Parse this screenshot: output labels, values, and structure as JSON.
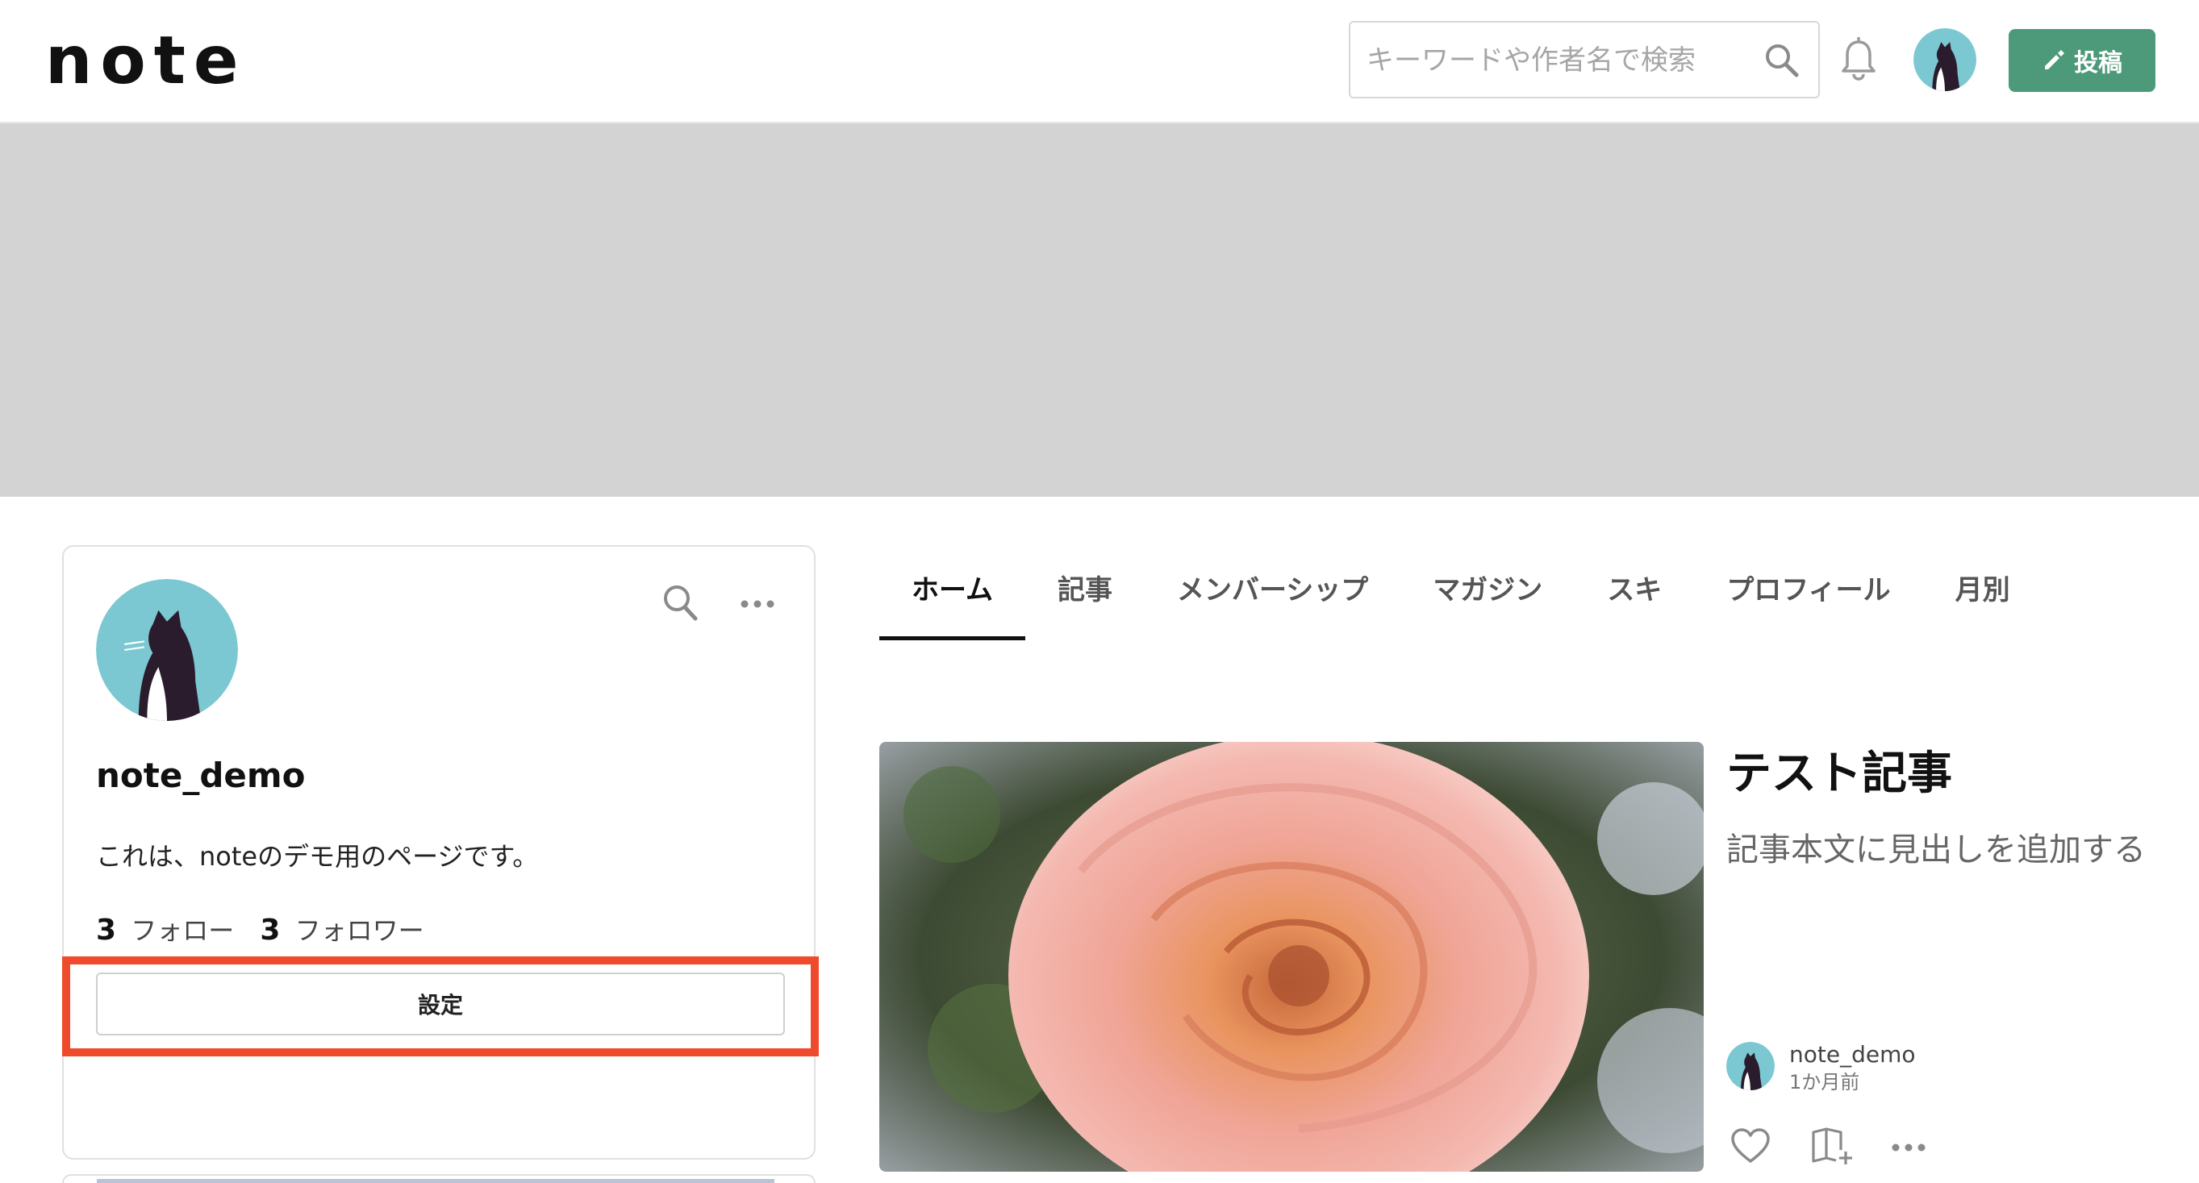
{
  "header": {
    "logo": "note",
    "search": {
      "placeholder": "キーワードや作者名で検索",
      "value": ""
    },
    "post_button": "投稿",
    "icons": [
      "search-icon",
      "bell-icon",
      "avatar",
      "pencil-icon"
    ]
  },
  "profile": {
    "name": "note_demo",
    "description": "これは、noteのデモ用のページです。",
    "following_count": "3",
    "following_label": "フォロー",
    "followers_count": "3",
    "followers_label": "フォロワー",
    "settings_button": "設定",
    "icons": [
      "search-icon",
      "more-icon"
    ]
  },
  "tabs": [
    {
      "label": "ホーム",
      "active": true
    },
    {
      "label": "記事",
      "active": false
    },
    {
      "label": "メンバーシップ",
      "active": false
    },
    {
      "label": "マガジン",
      "active": false
    },
    {
      "label": "スキ",
      "active": false
    },
    {
      "label": "プロフィール",
      "active": false
    },
    {
      "label": "月別",
      "active": false
    }
  ],
  "article": {
    "title": "テスト記事",
    "excerpt": "記事本文に見出しを追加する",
    "author": "note_demo",
    "date": "1か月前",
    "icons": [
      "heart-icon",
      "magazine-add-icon",
      "more-icon"
    ]
  },
  "colors": {
    "accent": "#4c9a7a",
    "cover": "#d3d3d3",
    "highlight": "#ee4a2b",
    "avatar_bg": "#7cc8d2"
  }
}
